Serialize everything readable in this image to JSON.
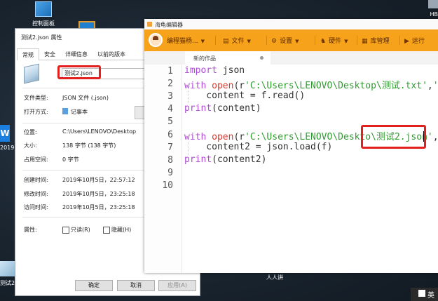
{
  "desktop": {
    "control_panel_label": "控制面板",
    "left_edge_label": "2019",
    "bottom_icon_label": "测试2.",
    "top_right_label": "HB",
    "taskbar_label": "人人讲",
    "ime_label": "英"
  },
  "properties_dialog": {
    "title": "测试2.json 属性",
    "tabs": [
      "常规",
      "安全",
      "详细信息",
      "以前的版本"
    ],
    "active_tab": "常规",
    "file_name": "测试2.json",
    "rows": [
      {
        "label": "文件类型:",
        "value": "JSON 文件 (.json)"
      },
      {
        "label": "打开方式:",
        "value": "记事本"
      },
      {
        "label": "位置:",
        "value": "C:\\Users\\LENOVO\\Desktop"
      },
      {
        "label": "大小:",
        "value": "138 字节 (138 字节)"
      },
      {
        "label": "占用空间:",
        "value": "0 字节"
      },
      {
        "label": "创建时间:",
        "value": "2019年10月5日，22:57:12"
      },
      {
        "label": "修改时间:",
        "value": "2019年10月5日，23:25:18"
      },
      {
        "label": "访问时间:",
        "value": "2019年10月5日，23:25:18"
      }
    ],
    "attributes_label": "属性:",
    "readonly_label": "只读(R)",
    "hidden_label": "隐藏(H)",
    "ok_button": "确定",
    "cancel_button": "取消",
    "apply_button": "应用(A)",
    "name_highlight_color": "#e3201d"
  },
  "editor": {
    "window_title": "海龟编辑器",
    "user_name": "编程猫杨...",
    "toolbar": [
      {
        "icon": "file-icon",
        "label": "文件"
      },
      {
        "icon": "gear-icon",
        "label": "设置"
      },
      {
        "icon": "hardware-icon",
        "label": "硬件"
      },
      {
        "icon": "library-icon",
        "label": "库管理"
      },
      {
        "icon": "play-icon",
        "label": "运行"
      }
    ],
    "tab_label": "新的作品",
    "line_numbers": [
      "1",
      "2",
      "3",
      "4",
      "5",
      "6",
      "7",
      "8",
      "9",
      "10"
    ],
    "code_lines": [
      "import json",
      "with open(r'C:\\Users\\LENOVO\\Desktop\\测试.txt','r',",
      "    content = f.read()",
      "print(content)",
      "",
      "with open(r'C:\\Users\\LENOVO\\Deskto\\测试2.json', ",
      "    content2 = json.load(f)",
      "print(content2)",
      "",
      ""
    ],
    "toolbar_color": "#f7a21b",
    "keyword_color": "#b04ad6",
    "builtin_color": "#e0372b",
    "string_color": "#2f9b2f",
    "highlight_color": "#e3201d"
  }
}
